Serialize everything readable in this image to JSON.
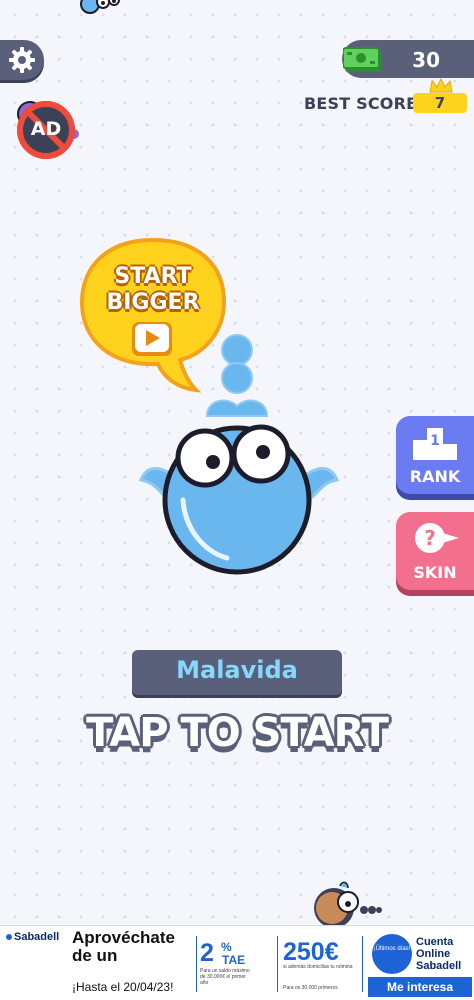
{
  "hud": {
    "money": "30",
    "best_score_label": "BEST SCORE",
    "best_score": "7",
    "no_ads_label": "AD"
  },
  "promo": {
    "line1": "START",
    "line2": "BIGGER"
  },
  "side_buttons": {
    "rank_label": "RANK",
    "rank_number": "1",
    "skin_label": "SKIN"
  },
  "player": {
    "name": "Malavida"
  },
  "prompt": "TAP TO START",
  "ad": {
    "brand": "Sabadell",
    "headline": "Aprovéchate de un",
    "date": "¡Hasta el 20/04/23!",
    "rate": "2",
    "rate_pct": "%",
    "rate_unit": "TAE",
    "rate_note": "Para un saldo máximo de 30.000€ el primer año",
    "amount": "250€",
    "amount_note": "si además domicilias tu nómina",
    "amount_note2": "Para os 30.000 primeros",
    "circle_text": "¡Últimos días!",
    "cta_title": "Cuenta Online Sabadell",
    "cta_button": "Me interesa"
  },
  "colors": {
    "panel": "#5a5f7a",
    "accent_yellow": "#ffd21e",
    "rank_blue": "#6b7bf2",
    "skin_pink": "#f2708d",
    "character_blue": "#6ab7f0",
    "name_text": "#86d8ff"
  },
  "icons": {
    "settings": "gear-icon",
    "money": "cash-icon",
    "crown": "crown-icon",
    "rank": "podium-icon",
    "skin": "question-icon",
    "play": "play-icon"
  }
}
